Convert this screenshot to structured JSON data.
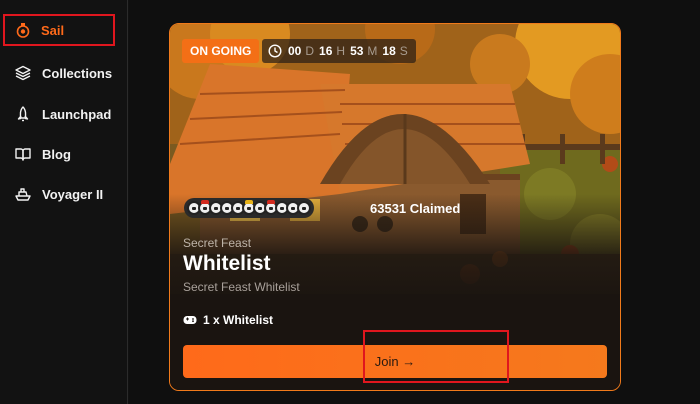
{
  "sidebar": {
    "items": [
      {
        "label": "Sail",
        "icon": "sail-badge-icon",
        "active": true
      },
      {
        "label": "Collections",
        "icon": "layers-icon"
      },
      {
        "label": "Launchpad",
        "icon": "rocket-icon"
      },
      {
        "label": "Blog",
        "icon": "book-icon"
      },
      {
        "label": "Voyager II",
        "icon": "ship-icon"
      }
    ]
  },
  "card": {
    "status": "ON GOING",
    "countdown": {
      "days": "00",
      "days_unit": "D",
      "hours": "16",
      "hours_unit": "H",
      "minutes": "53",
      "minutes_unit": "M",
      "seconds": "18",
      "seconds_unit": "S"
    },
    "claimed": "63531 Claimed",
    "collection": "Secret Feast",
    "title": "Whitelist",
    "description": "Secret Feast Whitelist",
    "whitelist_count": "1 x Whitelist",
    "join_label": "Join →"
  },
  "colors": {
    "accent": "#ff6a1a",
    "highlight_outline": "#e0161e",
    "background": "#111111"
  }
}
